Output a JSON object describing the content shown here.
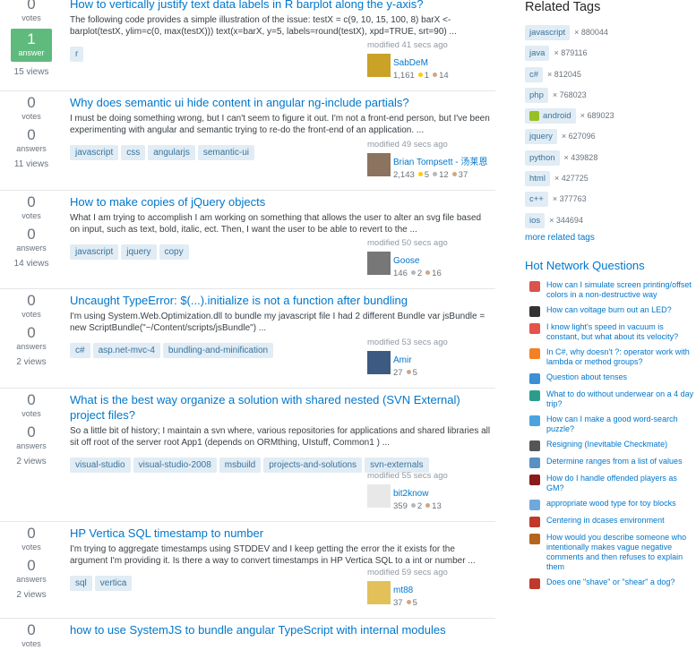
{
  "questions": [
    {
      "votes": "0",
      "votes_label": "votes",
      "answers": "1",
      "answers_label": "answer",
      "answered": true,
      "views": "15 views",
      "title": "How to vertically justify text data labels in R barplot along the y-axis?",
      "excerpt": "The following code provides a simple illustration of the issue: testX = c(9, 10, 15, 100, 8) barX <- barplot(testX, ylim=c(0, max(testX))) text(x=barX, y=5, labels=round(testX), xpd=TRUE, srt=90) ...",
      "tags": [
        "r"
      ],
      "modified": "modified 41 secs ago",
      "owner": "SabDeM",
      "rep": "1,161",
      "gold": "1",
      "silver": "",
      "bronze": "14",
      "avatar_color": "#c9a227"
    },
    {
      "votes": "0",
      "votes_label": "votes",
      "answers": "0",
      "answers_label": "answers",
      "answered": false,
      "views": "11 views",
      "title": "Why does semantic ui hide content in angular ng-include partials?",
      "excerpt": "I must be doing something wrong, but I can't seem to figure it out. I'm not a front-end person, but I've been experimenting with angular and semantic trying to re-do the front-end of an application. ...",
      "tags": [
        "javascript",
        "css",
        "angularjs",
        "semantic-ui"
      ],
      "modified": "modified 49 secs ago",
      "owner": "Brian Tompsett - 汤莱恩",
      "rep": "2,143",
      "gold": "5",
      "silver": "12",
      "bronze": "37",
      "avatar_color": "#8b7360"
    },
    {
      "votes": "0",
      "votes_label": "votes",
      "answers": "0",
      "answers_label": "answers",
      "answered": false,
      "views": "14 views",
      "title": "How to make copies of jQuery objects",
      "excerpt": "What I am trying to accomplish I am working on something that allows the user to alter an svg file based on input, such as text, bold, italic, ect. Then, I want the user to be able to revert to the ...",
      "tags": [
        "javascript",
        "jquery",
        "copy"
      ],
      "modified": "modified 50 secs ago",
      "owner": "Goose",
      "rep": "146",
      "gold": "",
      "silver": "2",
      "bronze": "16",
      "avatar_color": "#777777"
    },
    {
      "votes": "0",
      "votes_label": "votes",
      "answers": "0",
      "answers_label": "answers",
      "answered": false,
      "views": "2 views",
      "title": "Uncaught TypeError: $(...).initialize is not a function after bundling",
      "excerpt": "I'm using System.Web.Optimization.dll to bundle my javascript file I had 2 different Bundle var jsBundle = new ScriptBundle(\"~/Content/scripts/jsBundle\") ...",
      "tags": [
        "c#",
        "asp.net-mvc-4",
        "bundling-and-minification"
      ],
      "modified": "modified 53 secs ago",
      "owner": "Amir",
      "rep": "27",
      "gold": "",
      "silver": "",
      "bronze": "5",
      "avatar_color": "#3d5a80"
    },
    {
      "votes": "0",
      "votes_label": "votes",
      "answers": "0",
      "answers_label": "answers",
      "answered": false,
      "views": "2 views",
      "title": "What is the best way organize a solution with shared nested (SVN External) project files?",
      "excerpt": "So a little bit of history; I maintain a svn where, various repositories for applications and shared libraries all sit off root of the server root App1 (depends on ORMthing, UIstuff, Common1 ) ...",
      "tags": [
        "visual-studio",
        "visual-studio-2008",
        "msbuild",
        "projects-and-solutions",
        "svn-externals"
      ],
      "modified": "modified 55 secs ago",
      "owner": "bit2know",
      "rep": "359",
      "gold": "",
      "silver": "2",
      "bronze": "13",
      "avatar_color": "#e8e8e8"
    },
    {
      "votes": "0",
      "votes_label": "votes",
      "answers": "0",
      "answers_label": "answers",
      "answered": false,
      "views": "2 views",
      "title": "HP Vertica SQL timestamp to number",
      "excerpt": "I'm trying to aggregate timestamps using STDDEV and I keep getting the error the it exists for the argument I'm providing it. Is there a way to convert timestamps in HP Vertica SQL to a int or number ...",
      "tags": [
        "sql",
        "vertica"
      ],
      "modified": "modified 59 secs ago",
      "owner": "mt88",
      "rep": "37",
      "gold": "",
      "silver": "",
      "bronze": "5",
      "avatar_color": "#e2c15b"
    },
    {
      "votes": "0",
      "votes_label": "votes",
      "answers": "",
      "answers_label": "",
      "answered": false,
      "views": "",
      "title": "how to use SystemJS to bundle angular TypeScript with internal modules",
      "excerpt": "",
      "tags": [],
      "modified": "",
      "owner": "",
      "rep": "",
      "gold": "",
      "silver": "",
      "bronze": "",
      "avatar_color": ""
    }
  ],
  "sidebar": {
    "related_tags_heading": "Related Tags",
    "related_tags": [
      {
        "name": "javascript",
        "count": "× 880044"
      },
      {
        "name": "java",
        "count": "× 879116"
      },
      {
        "name": "c#",
        "count": "× 812045"
      },
      {
        "name": "php",
        "count": "× 768023"
      },
      {
        "name": "android",
        "count": "× 689023",
        "icon": "android-icon"
      },
      {
        "name": "jquery",
        "count": "× 627096"
      },
      {
        "name": "python",
        "count": "× 439828"
      },
      {
        "name": "html",
        "count": "× 427725"
      },
      {
        "name": "c++",
        "count": "× 377763"
      },
      {
        "name": "ios",
        "count": "× 344694"
      }
    ],
    "more_related_tags": "more related tags",
    "hnq_heading": "Hot Network Questions",
    "hnq": [
      {
        "title": "How can I simulate screen printing/offset colors in a non-destructive way",
        "icon_color": "#d9534f"
      },
      {
        "title": "How can voltage burn out an LED?",
        "icon_color": "#333333"
      },
      {
        "title": "I know light's speed in vacuum is constant, but what about its velocity?",
        "icon_color": "#e5534b"
      },
      {
        "title": "In C#, why doesn't ?: operator work with lambda or method groups?",
        "icon_color": "#f48024"
      },
      {
        "title": "Question about tenses",
        "icon_color": "#3b8fd6"
      },
      {
        "title": "What to do without underwear on a 4 day trip?",
        "icon_color": "#2a9d8f"
      },
      {
        "title": "How can I make a good word-search puzzle?",
        "icon_color": "#4aa3df"
      },
      {
        "title": "Resigning (Inevitable Checkmate)",
        "icon_color": "#555555"
      },
      {
        "title": "Determine ranges from a list of values",
        "icon_color": "#5a8fc2"
      },
      {
        "title": "How do I handle offended players as GM?",
        "icon_color": "#8b1a1a"
      },
      {
        "title": "appropriate wood type for toy blocks",
        "icon_color": "#6fa8dc"
      },
      {
        "title": "Centering in dcases environment",
        "icon_color": "#c0392b"
      },
      {
        "title": "How would you describe someone who intentionally makes vague negative comments and then refuses to explain them",
        "icon_color": "#b5651d"
      },
      {
        "title": "Does one \"shave\" or \"shear\" a dog?",
        "icon_color": "#c0392b"
      }
    ]
  }
}
